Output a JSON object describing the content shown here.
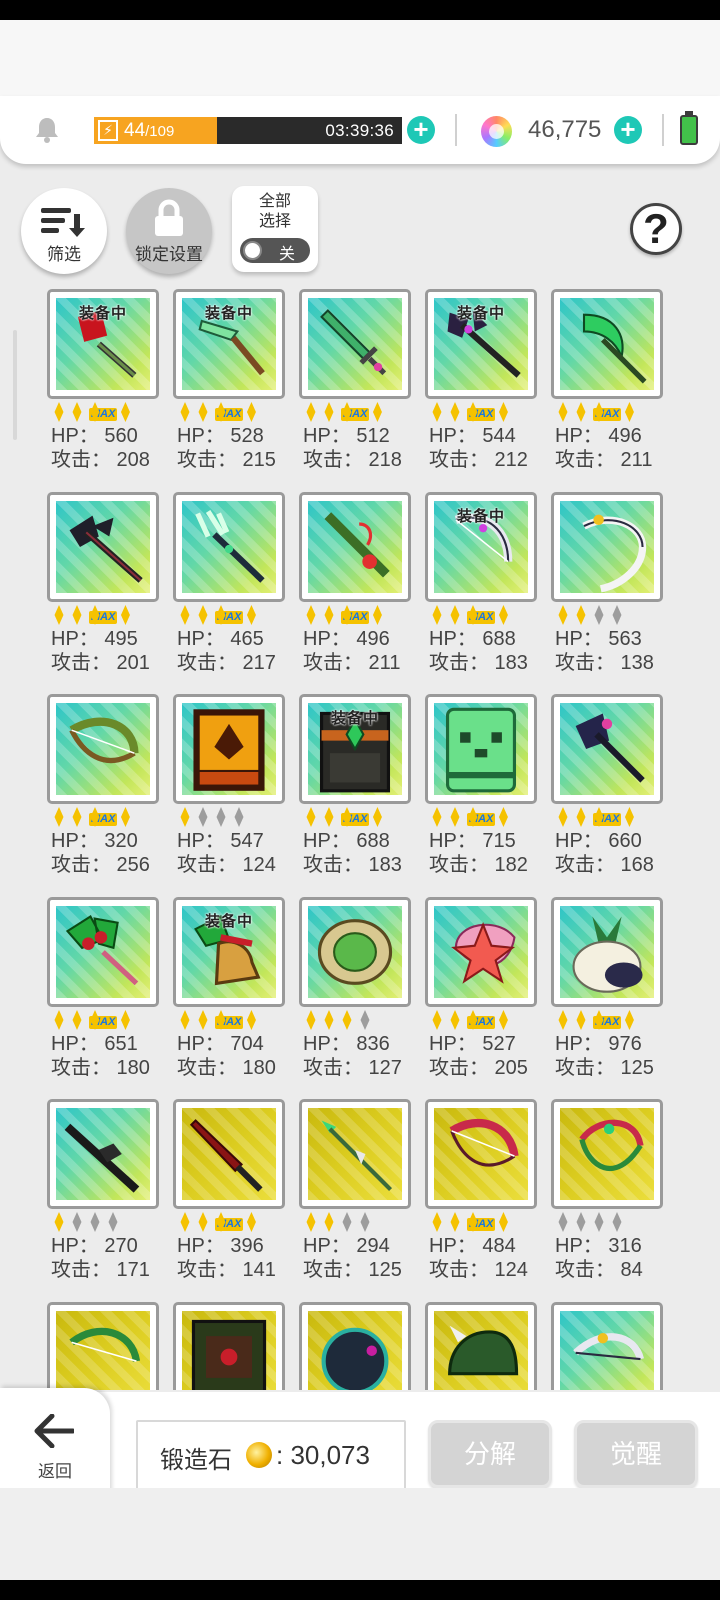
{
  "energy": {
    "current": "44",
    "max": "/109",
    "fill_fraction": 0.4,
    "timer": "03:39:36"
  },
  "gems": {
    "value": "46,775"
  },
  "toolbar": {
    "filter_label": "筛选",
    "lock_label": "锁定设置",
    "select_all_label": "全部\n选择",
    "toggle_label": "关"
  },
  "help_label": "?",
  "equip_label": "装备中",
  "max_label": "MAX",
  "hp_prefix": "HP：",
  "atk_prefix": "攻击：",
  "items": [
    {
      "hp": "560",
      "atk": "208",
      "stars": 2,
      "max": true,
      "equipped": true,
      "bg": "blue",
      "icon": "red-flag-axe-icon"
    },
    {
      "hp": "528",
      "atk": "215",
      "stars": 2,
      "max": true,
      "equipped": true,
      "bg": "blue",
      "icon": "jade-broom-icon"
    },
    {
      "hp": "512",
      "atk": "218",
      "stars": 2,
      "max": true,
      "equipped": false,
      "bg": "blue",
      "icon": "green-sword-icon"
    },
    {
      "hp": "544",
      "atk": "212",
      "stars": 2,
      "max": true,
      "equipped": true,
      "bg": "blue",
      "icon": "dark-halberd-icon"
    },
    {
      "hp": "496",
      "atk": "211",
      "stars": 2,
      "max": true,
      "equipped": false,
      "bg": "blue",
      "icon": "green-scythe-icon"
    },
    {
      "hp": "495",
      "atk": "201",
      "stars": 2,
      "max": true,
      "equipped": false,
      "bg": "blue",
      "icon": "black-halberd-icon"
    },
    {
      "hp": "465",
      "atk": "217",
      "stars": 2,
      "max": true,
      "equipped": false,
      "bg": "blue",
      "icon": "trident-icon"
    },
    {
      "hp": "496",
      "atk": "211",
      "stars": 2,
      "max": true,
      "equipped": false,
      "bg": "blue",
      "icon": "flute-staff-icon"
    },
    {
      "hp": "688",
      "atk": "183",
      "stars": 2,
      "max": true,
      "equipped": true,
      "bg": "blue",
      "icon": "crescent-bow-icon"
    },
    {
      "hp": "563",
      "atk": "138",
      "stars": 2,
      "max": false,
      "equipped": false,
      "bg": "blue",
      "icon": "white-bow-icon"
    },
    {
      "hp": "320",
      "atk": "256",
      "stars": 2,
      "max": true,
      "equipped": false,
      "bg": "blue",
      "icon": "vine-bow-icon"
    },
    {
      "hp": "547",
      "atk": "124",
      "stars": 1,
      "max": false,
      "equipped": false,
      "bg": "blue",
      "icon": "phoenix-tome-icon"
    },
    {
      "hp": "688",
      "atk": "183",
      "stars": 2,
      "max": true,
      "equipped": true,
      "bg": "blue",
      "icon": "emerald-tome-icon"
    },
    {
      "hp": "715",
      "atk": "182",
      "stars": 2,
      "max": true,
      "equipped": false,
      "bg": "blue",
      "icon": "slime-tome-icon"
    },
    {
      "hp": "660",
      "atk": "168",
      "stars": 2,
      "max": true,
      "equipped": false,
      "bg": "blue",
      "icon": "shadow-axe-icon"
    },
    {
      "hp": "651",
      "atk": "180",
      "stars": 2,
      "max": true,
      "equipped": false,
      "bg": "blue",
      "icon": "holly-staff-icon"
    },
    {
      "hp": "704",
      "atk": "180",
      "stars": 2,
      "max": true,
      "equipped": true,
      "bg": "blue",
      "icon": "holly-bell-icon"
    },
    {
      "hp": "836",
      "atk": "127",
      "stars": 3,
      "max": false,
      "equipped": false,
      "bg": "blue",
      "icon": "turtle-shell-icon"
    },
    {
      "hp": "527",
      "atk": "205",
      "stars": 2,
      "max": true,
      "equipped": false,
      "bg": "blue",
      "icon": "starfish-shell-icon"
    },
    {
      "hp": "976",
      "atk": "125",
      "stars": 2,
      "max": true,
      "equipped": false,
      "bg": "blue",
      "icon": "radish-pouch-icon"
    },
    {
      "hp": "270",
      "atk": "171",
      "stars": 1,
      "max": false,
      "equipped": false,
      "bg": "blue",
      "icon": "black-rifle-icon"
    },
    {
      "hp": "396",
      "atk": "141",
      "stars": 2,
      "max": true,
      "equipped": false,
      "bg": "gold",
      "icon": "crimson-blade-icon"
    },
    {
      "hp": "294",
      "atk": "125",
      "stars": 2,
      "max": false,
      "equipped": false,
      "bg": "gold",
      "icon": "green-spear-icon"
    },
    {
      "hp": "484",
      "atk": "124",
      "stars": 2,
      "max": true,
      "equipped": false,
      "bg": "gold",
      "icon": "red-bow-icon"
    },
    {
      "hp": "316",
      "atk": "84",
      "stars": 0,
      "max": false,
      "equipped": false,
      "bg": "gold",
      "icon": "rose-bow-icon"
    },
    {
      "hp": "",
      "atk": "",
      "stars": 0,
      "max": false,
      "equipped": false,
      "bg": "gold",
      "icon": "leaf-bow-icon"
    },
    {
      "hp": "",
      "atk": "",
      "stars": 0,
      "max": false,
      "equipped": false,
      "bg": "gold",
      "icon": "dark-tome-icon"
    },
    {
      "hp": "",
      "atk": "",
      "stars": 0,
      "max": false,
      "equipped": false,
      "bg": "gold",
      "icon": "dark-orb-icon"
    },
    {
      "hp": "",
      "atk": "",
      "stars": 0,
      "max": false,
      "equipped": false,
      "bg": "gold",
      "icon": "horned-helm-icon"
    },
    {
      "hp": "",
      "atk": "",
      "stars": 0,
      "max": false,
      "equipped": false,
      "bg": "blue",
      "icon": "silver-bow-icon"
    }
  ],
  "bottom": {
    "back_label": "返回",
    "stone_label": "锻造石",
    "stone_value": ": 30,073",
    "dismantle_label": "分解",
    "awaken_label": "觉醒"
  },
  "colors": {
    "accent": "#1ec8b6",
    "energy": "#f7a420",
    "star": "#f5c200",
    "max_text": "#1976e0"
  }
}
